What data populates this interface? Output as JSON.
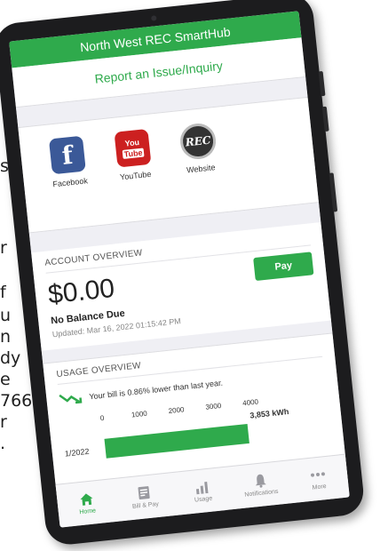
{
  "background_text": [
    "s",
    "r",
    "f",
    "u",
    "n",
    "dy",
    "e",
    "766-",
    "r",
    "."
  ],
  "app": {
    "title": "North West REC SmartHub",
    "report_link": "Report an Issue/Inquiry"
  },
  "social": [
    {
      "label": "Facebook",
      "glyph": "f",
      "icon": "facebook-icon"
    },
    {
      "label": "YouTube",
      "glyph_top": "You",
      "glyph_bottom": "Tube",
      "icon": "youtube-icon"
    },
    {
      "label": "Website",
      "glyph": "REC",
      "icon": "rec-logo-icon"
    }
  ],
  "account": {
    "header": "ACCOUNT OVERVIEW",
    "balance": "$0.00",
    "status": "No Balance Due",
    "updated": "Updated: Mar 16, 2022 01:15:42 PM",
    "pay_label": "Pay"
  },
  "usage": {
    "header": "USAGE OVERVIEW",
    "trend_text": "Your bill is 0.86% lower than last year.",
    "trend_icon": "trend-down-icon",
    "value_label": "3,853 kWh"
  },
  "chart_data": {
    "type": "bar",
    "orientation": "horizontal",
    "categories": [
      "1/2022"
    ],
    "values": [
      3853
    ],
    "xlim": [
      0,
      4000
    ],
    "xticks": [
      0,
      1000,
      2000,
      3000,
      4000
    ],
    "unit": "kWh",
    "color": "#2faa4c"
  },
  "tabs": [
    {
      "label": "Home",
      "icon": "home-icon",
      "active": true
    },
    {
      "label": "Bill & Pay",
      "icon": "bill-icon",
      "active": false
    },
    {
      "label": "Usage",
      "icon": "usage-chart-icon",
      "active": false
    },
    {
      "label": "Notifications",
      "icon": "bell-icon",
      "active": false
    },
    {
      "label": "More",
      "icon": "more-dots-icon",
      "active": false
    }
  ],
  "colors": {
    "accent": "#2faa4c",
    "bezel": "#1c1c1e"
  }
}
